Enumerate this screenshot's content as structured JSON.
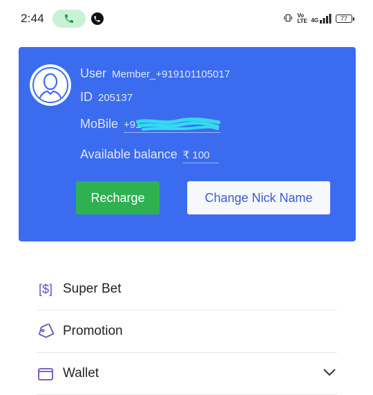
{
  "status_bar": {
    "time": "2:44",
    "icons": [
      "phone-call-icon",
      "whatsapp-icon",
      "vibrate-icon",
      "volte-icon",
      "signal-4g-icon",
      "battery-icon"
    ],
    "volte_text": "Vo LTE",
    "network_text": "4G",
    "battery_level": "77"
  },
  "profile": {
    "user_label": "User",
    "user_value": "Member_+919101105017",
    "id_label": "ID",
    "id_value": "205137",
    "mobile_label": "MoBile",
    "mobile_value": "+91",
    "balance_label": "Available balance",
    "balance_value": "₹ 100",
    "avatar_icon": "user-avatar-icon",
    "recharge_label": "Recharge",
    "change_nick_label": "Change Nick Name"
  },
  "menu": {
    "items": [
      {
        "label": "Super Bet",
        "icon": "dollar-bracket-icon"
      },
      {
        "label": "Promotion",
        "icon": "tag-icon"
      },
      {
        "label": "Wallet",
        "icon": "wallet-icon"
      }
    ]
  },
  "colors": {
    "card_bg": "#3b6cf0",
    "recharge_bg": "#2fb151",
    "nick_btn_bg": "#f7f8fb",
    "accent_purple": "#6b4fbf",
    "call_pill": "#c8f1d6"
  }
}
